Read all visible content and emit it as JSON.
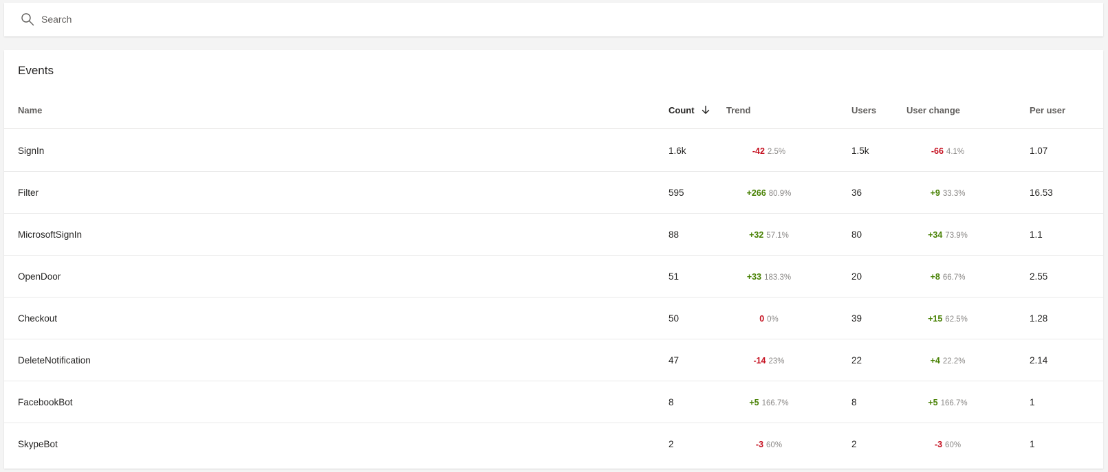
{
  "search": {
    "placeholder": "Search"
  },
  "events": {
    "title": "Events",
    "columns": {
      "name": "Name",
      "count": "Count",
      "trend": "Trend",
      "users": "Users",
      "user_change": "User change",
      "per_user": "Per user"
    },
    "sort": {
      "column": "count",
      "direction": "descending"
    },
    "colors": {
      "positive": "#498205",
      "negative": "#c50f1f"
    },
    "rows": [
      {
        "name": "SignIn",
        "count": "1.6k",
        "trend_delta": "-42",
        "trend_pct": "2.5%",
        "trend_dir": "neg",
        "users": "1.5k",
        "user_delta": "-66",
        "user_pct": "4.1%",
        "user_dir": "neg",
        "per_user": "1.07"
      },
      {
        "name": "Filter",
        "count": "595",
        "trend_delta": "+266",
        "trend_pct": "80.9%",
        "trend_dir": "pos",
        "users": "36",
        "user_delta": "+9",
        "user_pct": "33.3%",
        "user_dir": "pos",
        "per_user": "16.53"
      },
      {
        "name": "MicrosoftSignIn",
        "count": "88",
        "trend_delta": "+32",
        "trend_pct": "57.1%",
        "trend_dir": "pos",
        "users": "80",
        "user_delta": "+34",
        "user_pct": "73.9%",
        "user_dir": "pos",
        "per_user": "1.1"
      },
      {
        "name": "OpenDoor",
        "count": "51",
        "trend_delta": "+33",
        "trend_pct": "183.3%",
        "trend_dir": "pos",
        "users": "20",
        "user_delta": "+8",
        "user_pct": "66.7%",
        "user_dir": "pos",
        "per_user": "2.55"
      },
      {
        "name": "Checkout",
        "count": "50",
        "trend_delta": "0",
        "trend_pct": "0%",
        "trend_dir": "neg",
        "users": "39",
        "user_delta": "+15",
        "user_pct": "62.5%",
        "user_dir": "pos",
        "per_user": "1.28"
      },
      {
        "name": "DeleteNotification",
        "count": "47",
        "trend_delta": "-14",
        "trend_pct": "23%",
        "trend_dir": "neg",
        "users": "22",
        "user_delta": "+4",
        "user_pct": "22.2%",
        "user_dir": "pos",
        "per_user": "2.14"
      },
      {
        "name": "FacebookBot",
        "count": "8",
        "trend_delta": "+5",
        "trend_pct": "166.7%",
        "trend_dir": "pos",
        "users": "8",
        "user_delta": "+5",
        "user_pct": "166.7%",
        "user_dir": "pos",
        "per_user": "1"
      },
      {
        "name": "SkypeBot",
        "count": "2",
        "trend_delta": "-3",
        "trend_pct": "60%",
        "trend_dir": "neg",
        "users": "2",
        "user_delta": "-3",
        "user_pct": "60%",
        "user_dir": "neg",
        "per_user": "1"
      }
    ]
  }
}
